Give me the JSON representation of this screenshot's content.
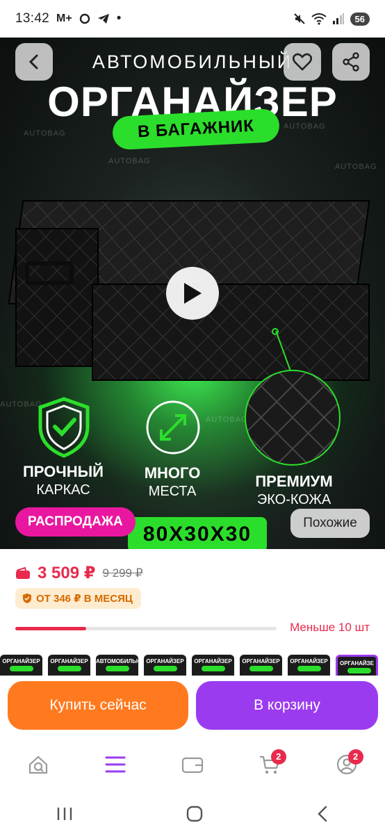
{
  "status_bar": {
    "time": "13:42",
    "left_icons": "M+",
    "dot": "•",
    "battery": "56"
  },
  "hero": {
    "title_small": "АВТОМОБИЛЬНЫЙ",
    "title_big": "ОРГАНАЙЗЕР",
    "title_pill": "В БАГАЖНИК",
    "watermark": "AUTOBAG",
    "features": [
      {
        "title": "ПРОЧНЫЙ",
        "subtitle": "КАРКАС"
      },
      {
        "title": "МНОГО",
        "subtitle": "МЕСТА"
      },
      {
        "title": "ПРЕМИУМ",
        "subtitle": "ЭКО-КОЖА"
      }
    ],
    "dimensions": "80X30X30",
    "sale_tag": "РАСПРОДАЖА",
    "similar_button": "Похожие",
    "icons": {
      "back": "chevron-left-icon",
      "favorite": "heart-icon",
      "share": "share-icon",
      "play": "play-icon"
    }
  },
  "price": {
    "current": "3 509 ₽",
    "old": "9 299 ₽",
    "installment": "ОТ 346 ₽ В МЕСЯЦ"
  },
  "stock": {
    "label": "Меньше 10 шт",
    "level": 0.27
  },
  "thumbnails": [
    {
      "label": "ОРГАНАЙЗЕР"
    },
    {
      "label": "ОРГАНАЙЗЕР"
    },
    {
      "label": "АВТОМОБИЛЬНЫЙ"
    },
    {
      "label": "ОРГАНАЙЗЕР"
    },
    {
      "label": "ОРГАНАЙЗЕР"
    },
    {
      "label": "ОРГАНАЙЗЕР"
    },
    {
      "label": "ОРГАНАЙЗЕР"
    },
    {
      "label": "ОРГАНАЙЗЕ"
    }
  ],
  "actions": {
    "buy_now": "Купить сейчас",
    "add_to_cart": "В корзину"
  },
  "bottom_nav": {
    "items": [
      {
        "icon": "home-search-icon",
        "badge": ""
      },
      {
        "icon": "catalog-menu-icon",
        "badge": ""
      },
      {
        "icon": "wallet-icon",
        "badge": ""
      },
      {
        "icon": "cart-icon",
        "badge": "2"
      },
      {
        "icon": "profile-icon",
        "badge": "2"
      }
    ]
  },
  "colors": {
    "accent_purple": "#9b3bf0",
    "accent_orange": "#ff7a1f",
    "price_red": "#e82a4d",
    "sale_pink": "#e9179f",
    "promo_green": "#2cde2c"
  }
}
